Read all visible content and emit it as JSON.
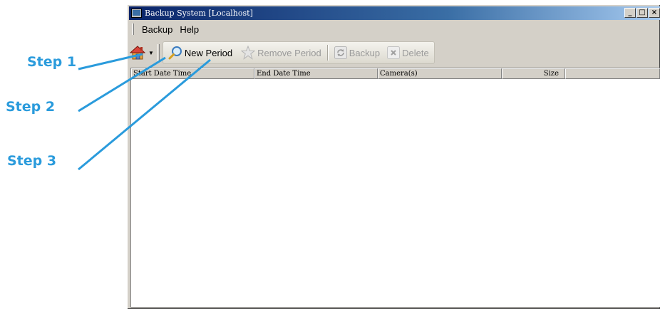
{
  "window": {
    "title": "Backup System [Localhost]",
    "controls": [
      "_",
      "□",
      "×"
    ]
  },
  "menu": {
    "items": [
      "Backup",
      "Help"
    ]
  },
  "toolbar": {
    "new_period": "New Period",
    "remove_period": "Remove Period",
    "backup": "Backup",
    "delete": "Delete"
  },
  "table": {
    "columns": [
      "Start Date Time",
      "End Date Time",
      "Camera(s)",
      "Size"
    ],
    "rows": []
  },
  "annotations": {
    "step1": "Step 1",
    "step2": "Step 2",
    "step3": "Step 3",
    "color": "#2a9bdc"
  },
  "icons": {
    "home": "home-icon",
    "new_period": "magnifier-icon",
    "remove_period": "star-icon",
    "backup": "refresh-icon",
    "delete": "x-icon"
  }
}
